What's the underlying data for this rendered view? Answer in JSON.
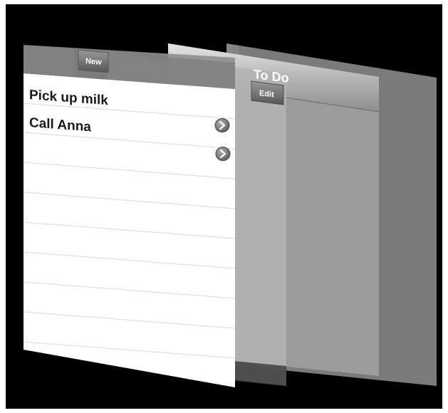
{
  "navigation_bar": {
    "title": "To Do",
    "new_button_label": "New",
    "edit_button_label": "Edit"
  },
  "todo_list": {
    "items": [
      {
        "label": "Pick up milk",
        "has_disclosure": false
      },
      {
        "label": "Call Anna",
        "has_disclosure": true
      },
      {
        "label": "",
        "has_disclosure": true
      }
    ]
  },
  "colors": {
    "background": "#000000",
    "list_background": "#ffffff",
    "separator": "#d9d9d9",
    "text": "#1a1a1a",
    "disclosure": "#8a8a8a"
  }
}
